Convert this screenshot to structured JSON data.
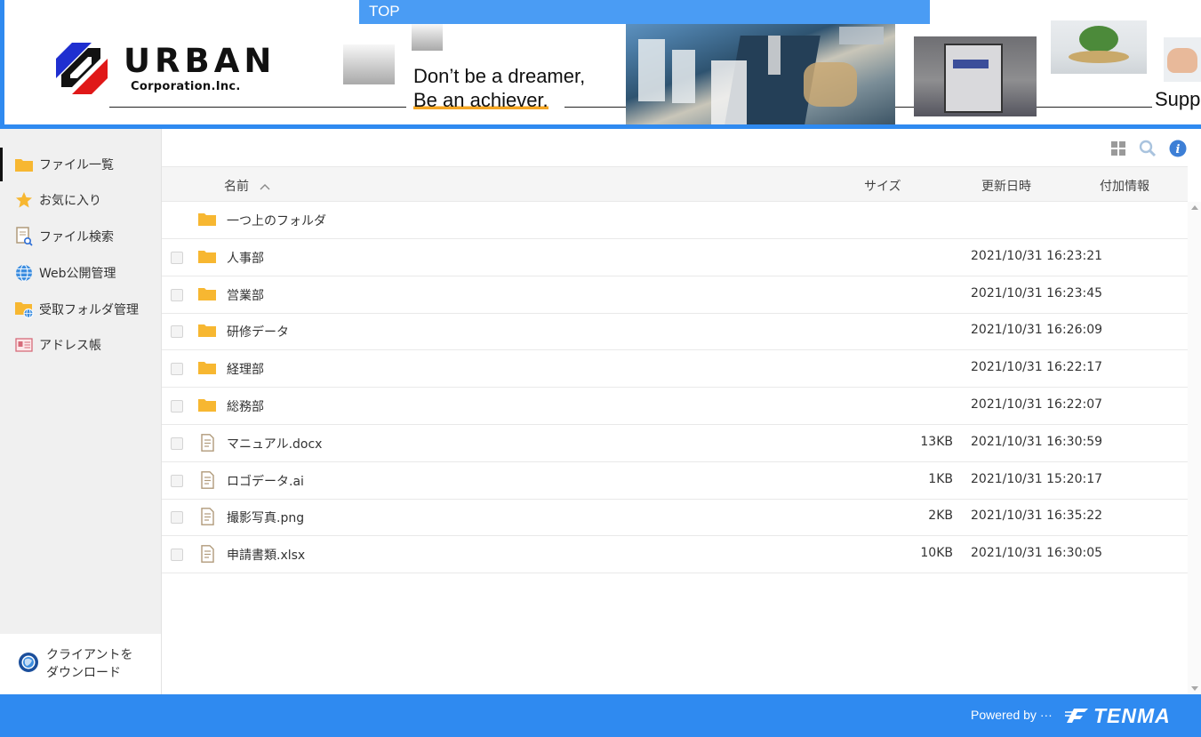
{
  "banner": {
    "top_tab": "TOP",
    "logo_word": "URBAN",
    "logo_sub": "Corporation.Inc.",
    "slogan_line1": "Don’t be a dreamer,",
    "slogan_line2": "Be an achiever.",
    "support_text": "Suppo",
    "accent_color": "#2f8af0"
  },
  "sidebar": {
    "items": [
      {
        "label": "ファイル一覧",
        "icon": "folder-icon"
      },
      {
        "label": "お気に入り",
        "icon": "star-icon"
      },
      {
        "label": "ファイル検索",
        "icon": "file-search-icon"
      },
      {
        "label": "Web公開管理",
        "icon": "globe-icon"
      },
      {
        "label": "受取フォルダ管理",
        "icon": "folder-globe-icon"
      },
      {
        "label": "アドレス帳",
        "icon": "address-card-icon"
      }
    ],
    "client_download_line1": "クライアントを",
    "client_download_line2": "ダウンロード"
  },
  "toolbar": {
    "icons": [
      "grid-view-icon",
      "search-icon",
      "info-icon"
    ]
  },
  "table": {
    "headers": {
      "name": "名前",
      "size": "サイズ",
      "modified": "更新日時",
      "extra": "付加情報"
    },
    "parent_folder": "一つ上のフォルダ",
    "rows": [
      {
        "name": "人事部",
        "type": "folder",
        "size": "",
        "modified": "2021/10/31 16:23:21"
      },
      {
        "name": "営業部",
        "type": "folder",
        "size": "",
        "modified": "2021/10/31 16:23:45"
      },
      {
        "name": "研修データ",
        "type": "folder",
        "size": "",
        "modified": "2021/10/31 16:26:09"
      },
      {
        "name": "経理部",
        "type": "folder",
        "size": "",
        "modified": "2021/10/31 16:22:17"
      },
      {
        "name": "総務部",
        "type": "folder",
        "size": "",
        "modified": "2021/10/31 16:22:07"
      },
      {
        "name": "マニュアル.docx",
        "type": "file",
        "size": "13KB",
        "modified": "2021/10/31 16:30:59"
      },
      {
        "name": "ロゴデータ.ai",
        "type": "file",
        "size": "1KB",
        "modified": "2021/10/31 15:20:17"
      },
      {
        "name": "撮影写真.png",
        "type": "file",
        "size": "2KB",
        "modified": "2021/10/31 16:35:22"
      },
      {
        "name": "申請書類.xlsx",
        "type": "file",
        "size": "10KB",
        "modified": "2021/10/31 16:30:05"
      }
    ]
  },
  "footer": {
    "powered_by": "Powered by ···",
    "brand": "TENMA"
  }
}
